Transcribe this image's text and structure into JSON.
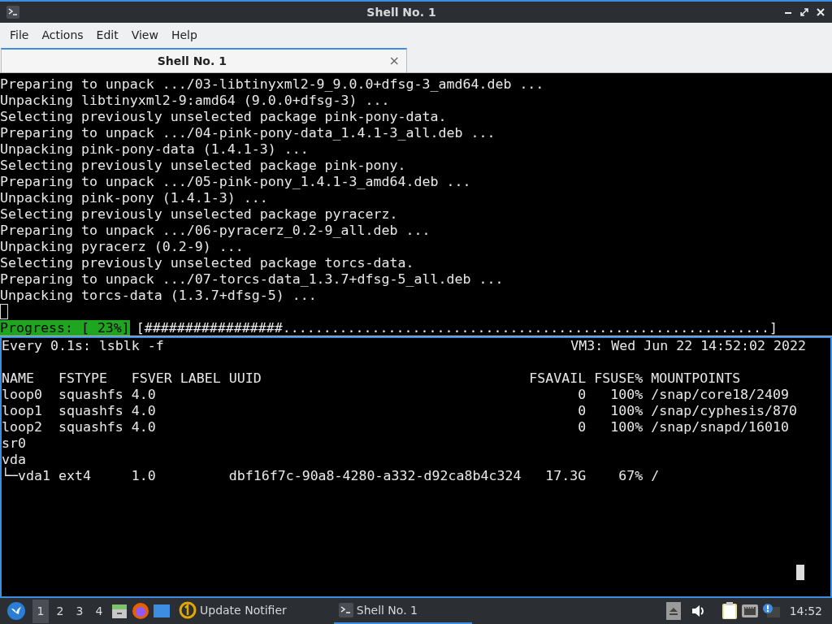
{
  "window": {
    "title": "Shell No. 1"
  },
  "menu": [
    "File",
    "Actions",
    "Edit",
    "View",
    "Help"
  ],
  "tabs": [
    {
      "label": "Shell No. 1",
      "selected": true,
      "close": "×"
    }
  ],
  "terminal_top": {
    "focused": false,
    "lines": [
      "Preparing to unpack .../03-libtinyxml2-9_9.0.0+dfsg-3_amd64.deb ...",
      "Unpacking libtinyxml2-9:amd64 (9.0.0+dfsg-3) ...",
      "Selecting previously unselected package pink-pony-data.",
      "Preparing to unpack .../04-pink-pony-data_1.4.1-3_all.deb ...",
      "Unpacking pink-pony-data (1.4.1-3) ...",
      "Selecting previously unselected package pink-pony.",
      "Preparing to unpack .../05-pink-pony_1.4.1-3_amd64.deb ...",
      "Unpacking pink-pony (1.4.1-3) ...",
      "Selecting previously unselected package pyracerz.",
      "Preparing to unpack .../06-pyracerz_0.2-9_all.deb ...",
      "Unpacking pyracerz (0.2-9) ...",
      "Selecting previously unselected package torcs-data.",
      "Preparing to unpack .../07-torcs-data_1.3.7+dfsg-5_all.deb ...",
      "Unpacking torcs-data (1.3.7+dfsg-5) ..."
    ],
    "progress": {
      "label": "Progress: [ 23%]",
      "bar": "[#################............................................................]"
    }
  },
  "terminal_bottom": {
    "focused": true,
    "command": "Every 0.1s: lsblk -f",
    "status": "VM3: Wed Jun 22 14:52:02 2022",
    "lines": [
      "NAME   FSTYPE   FSVER LABEL UUID                                 FSAVAIL FSUSE% MOUNTPOINTS",
      "loop0  squashfs 4.0                                                    0   100% /snap/core18/2409",
      "loop1  squashfs 4.0                                                    0   100% /snap/cyphesis/870",
      "loop2  squashfs 4.0                                                    0   100% /snap/snapd/16010",
      "sr0",
      "vda",
      "└─vda1 ext4     1.0         dbf16f7c-90a8-4280-a332-d92ca8b4c324   17.3G    67% /"
    ]
  },
  "taskbar": {
    "workspaces": [
      {
        "label": "1",
        "selected": true
      },
      {
        "label": "2",
        "selected": false
      },
      {
        "label": "3",
        "selected": false
      },
      {
        "label": "4",
        "selected": false
      }
    ],
    "tasks": [
      {
        "label": "Update Notifier",
        "kind": "notifier",
        "selected": false
      },
      {
        "label": "Shell No. 1",
        "kind": "terminal",
        "selected": true
      }
    ],
    "clock": "14:52"
  }
}
